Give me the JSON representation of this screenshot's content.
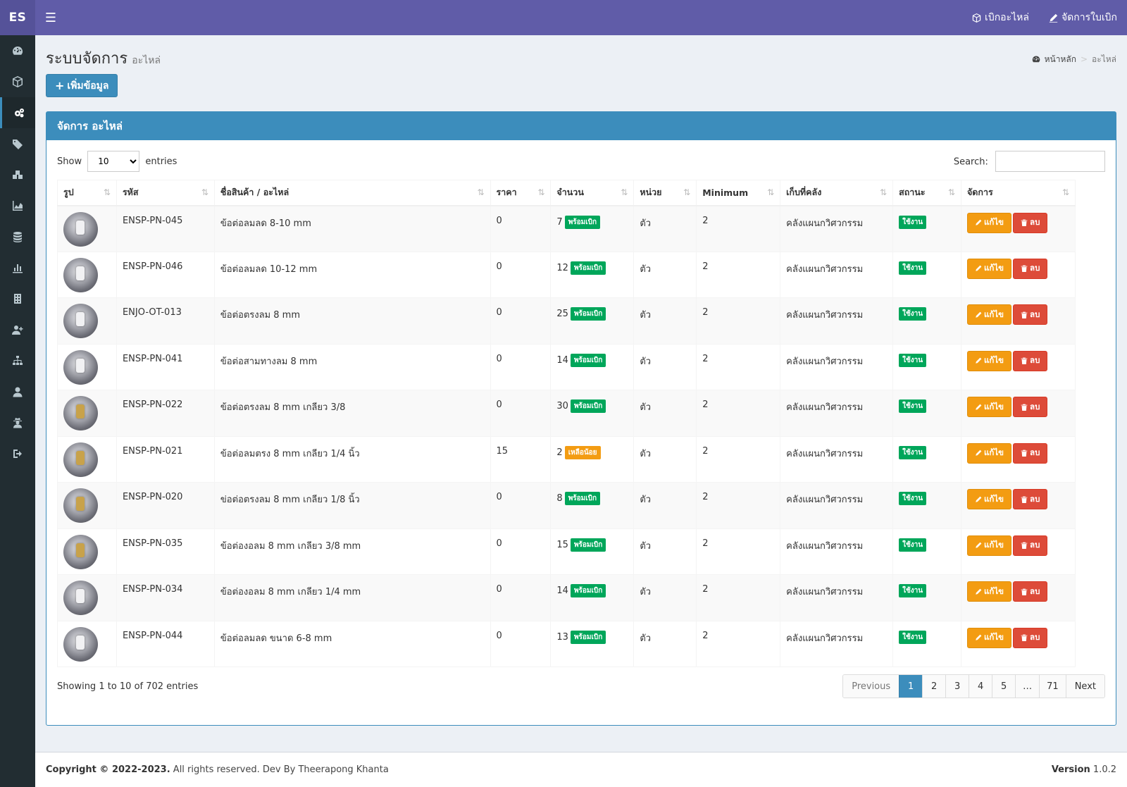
{
  "logo": "ES",
  "header": {
    "withdraw_label": "เบิกอะไหล่",
    "manage_label": "จัดการใบเบิก"
  },
  "sidebar": {
    "items": [
      {
        "icon": "dashboard-icon"
      },
      {
        "icon": "box-icon"
      },
      {
        "icon": "gears-icon"
      },
      {
        "icon": "tags-icon"
      },
      {
        "icon": "cubes-icon"
      },
      {
        "icon": "area-chart-icon"
      },
      {
        "icon": "database-icon"
      },
      {
        "icon": "bar-chart-icon"
      },
      {
        "icon": "building-icon"
      },
      {
        "icon": "user-plus-icon"
      },
      {
        "icon": "sitemap-icon"
      },
      {
        "icon": "user-icon"
      },
      {
        "icon": "user-secret-icon"
      },
      {
        "icon": "sign-out-icon"
      }
    ],
    "active_index": 2
  },
  "page": {
    "title": "ระบบจัดการ",
    "subtitle": "อะไหล่",
    "breadcrumb_home": "หน้าหลัก",
    "breadcrumb_current": "อะไหล่",
    "add_button": "เพิ่มข้อมูล"
  },
  "box": {
    "title": "จัดการ อะไหล่"
  },
  "datatable": {
    "show_label": "Show",
    "entries_label": "entries",
    "page_length": "10",
    "search_label": "Search:",
    "search_value": "",
    "info": "Showing 1 to 10 of 702 entries",
    "pagination": [
      "Previous",
      "1",
      "2",
      "3",
      "4",
      "5",
      "…",
      "71",
      "Next"
    ],
    "active_page": "1"
  },
  "table": {
    "columns": [
      "รูป",
      "รหัส",
      "ชื่อสินค้า / อะไหล่",
      "ราคา",
      "จำนวน",
      "หน่วย",
      "Minimum",
      "เก็บที่คลัง",
      "สถานะ",
      "จัดการ"
    ],
    "edit_label": "แก้ไข",
    "delete_label": "ลบ",
    "rows": [
      {
        "code": "ENSP-PN-045",
        "name": "ข้อต่อลมลด 8-10 mm",
        "price": "0",
        "qty": "7",
        "qty_badge": "พร้อมเบิก",
        "qty_badge_color": "#00a65a",
        "unit": "ตัว",
        "min": "2",
        "warehouse": "คลังแผนกวิศวกรรม",
        "status": "ใช้งาน"
      },
      {
        "code": "ENSP-PN-046",
        "name": "ข้อต่อลมลด 10-12 mm",
        "price": "0",
        "qty": "12",
        "qty_badge": "พร้อมเบิก",
        "qty_badge_color": "#00a65a",
        "unit": "ตัว",
        "min": "2",
        "warehouse": "คลังแผนกวิศวกรรม",
        "status": "ใช้งาน"
      },
      {
        "code": "ENJO-OT-013",
        "name": "ข้อต่อตรงลม 8 mm",
        "price": "0",
        "qty": "25",
        "qty_badge": "พร้อมเบิก",
        "qty_badge_color": "#00a65a",
        "unit": "ตัว",
        "min": "2",
        "warehouse": "คลังแผนกวิศวกรรม",
        "status": "ใช้งาน"
      },
      {
        "code": "ENSP-PN-041",
        "name": "ข้อต่อสามทางลม 8 mm",
        "price": "0",
        "qty": "14",
        "qty_badge": "พร้อมเบิก",
        "qty_badge_color": "#00a65a",
        "unit": "ตัว",
        "min": "2",
        "warehouse": "คลังแผนกวิศวกรรม",
        "status": "ใช้งาน"
      },
      {
        "code": "ENSP-PN-022",
        "name": "ข้อต่อตรงลม 8 mm เกลียว 3/8",
        "price": "0",
        "qty": "30",
        "qty_badge": "พร้อมเบิก",
        "qty_badge_color": "#00a65a",
        "unit": "ตัว",
        "min": "2",
        "warehouse": "คลังแผนกวิศวกรรม",
        "status": "ใช้งาน"
      },
      {
        "code": "ENSP-PN-021",
        "name": "ข้อต่อลมตรง 8 mm เกลียว 1/4 นิ้ว",
        "price": "15",
        "qty": "2",
        "qty_badge": "เหลือน้อย",
        "qty_badge_color": "#f39c12",
        "unit": "ตัว",
        "min": "2",
        "warehouse": "คลังแผนกวิศวกรรม",
        "status": "ใช้งาน"
      },
      {
        "code": "ENSP-PN-020",
        "name": "ข่อต่อตรงลม 8 mm เกลียว 1/8 นิ้ว",
        "price": "0",
        "qty": "8",
        "qty_badge": "พร้อมเบิก",
        "qty_badge_color": "#00a65a",
        "unit": "ตัว",
        "min": "2",
        "warehouse": "คลังแผนกวิศวกรรม",
        "status": "ใช้งาน"
      },
      {
        "code": "ENSP-PN-035",
        "name": "ข้อต่องอลม 8 mm เกลียว 3/8 mm",
        "price": "0",
        "qty": "15",
        "qty_badge": "พร้อมเบิก",
        "qty_badge_color": "#00a65a",
        "unit": "ตัว",
        "min": "2",
        "warehouse": "คลังแผนกวิศวกรรม",
        "status": "ใช้งาน"
      },
      {
        "code": "ENSP-PN-034",
        "name": "ข้อต่องอลม 8 mm เกลียว 1/4 mm",
        "price": "0",
        "qty": "14",
        "qty_badge": "พร้อมเบิก",
        "qty_badge_color": "#00a65a",
        "unit": "ตัว",
        "min": "2",
        "warehouse": "คลังแผนกวิศวกรรม",
        "status": "ใช้งาน"
      },
      {
        "code": "ENSP-PN-044",
        "name": "ข้อต่อลมลด ขนาด 6-8 mm",
        "price": "0",
        "qty": "13",
        "qty_badge": "พร้อมเบิก",
        "qty_badge_color": "#00a65a",
        "unit": "ตัว",
        "min": "2",
        "warehouse": "คลังแผนกวิศวกรรม",
        "status": "ใช้งาน"
      }
    ]
  },
  "footer": {
    "copyright": "Copyright © 2022-2023.",
    "rights": "All rights reserved. Dev By Theerapong Khanta",
    "version_label": "Version",
    "version": "1.0.2"
  },
  "colors": {
    "header_bg": "#605ca8",
    "sidebar_bg": "#222d32",
    "primary": "#3c8dbc",
    "success": "#00a65a",
    "warning": "#f39c12",
    "danger": "#dd4b39"
  }
}
